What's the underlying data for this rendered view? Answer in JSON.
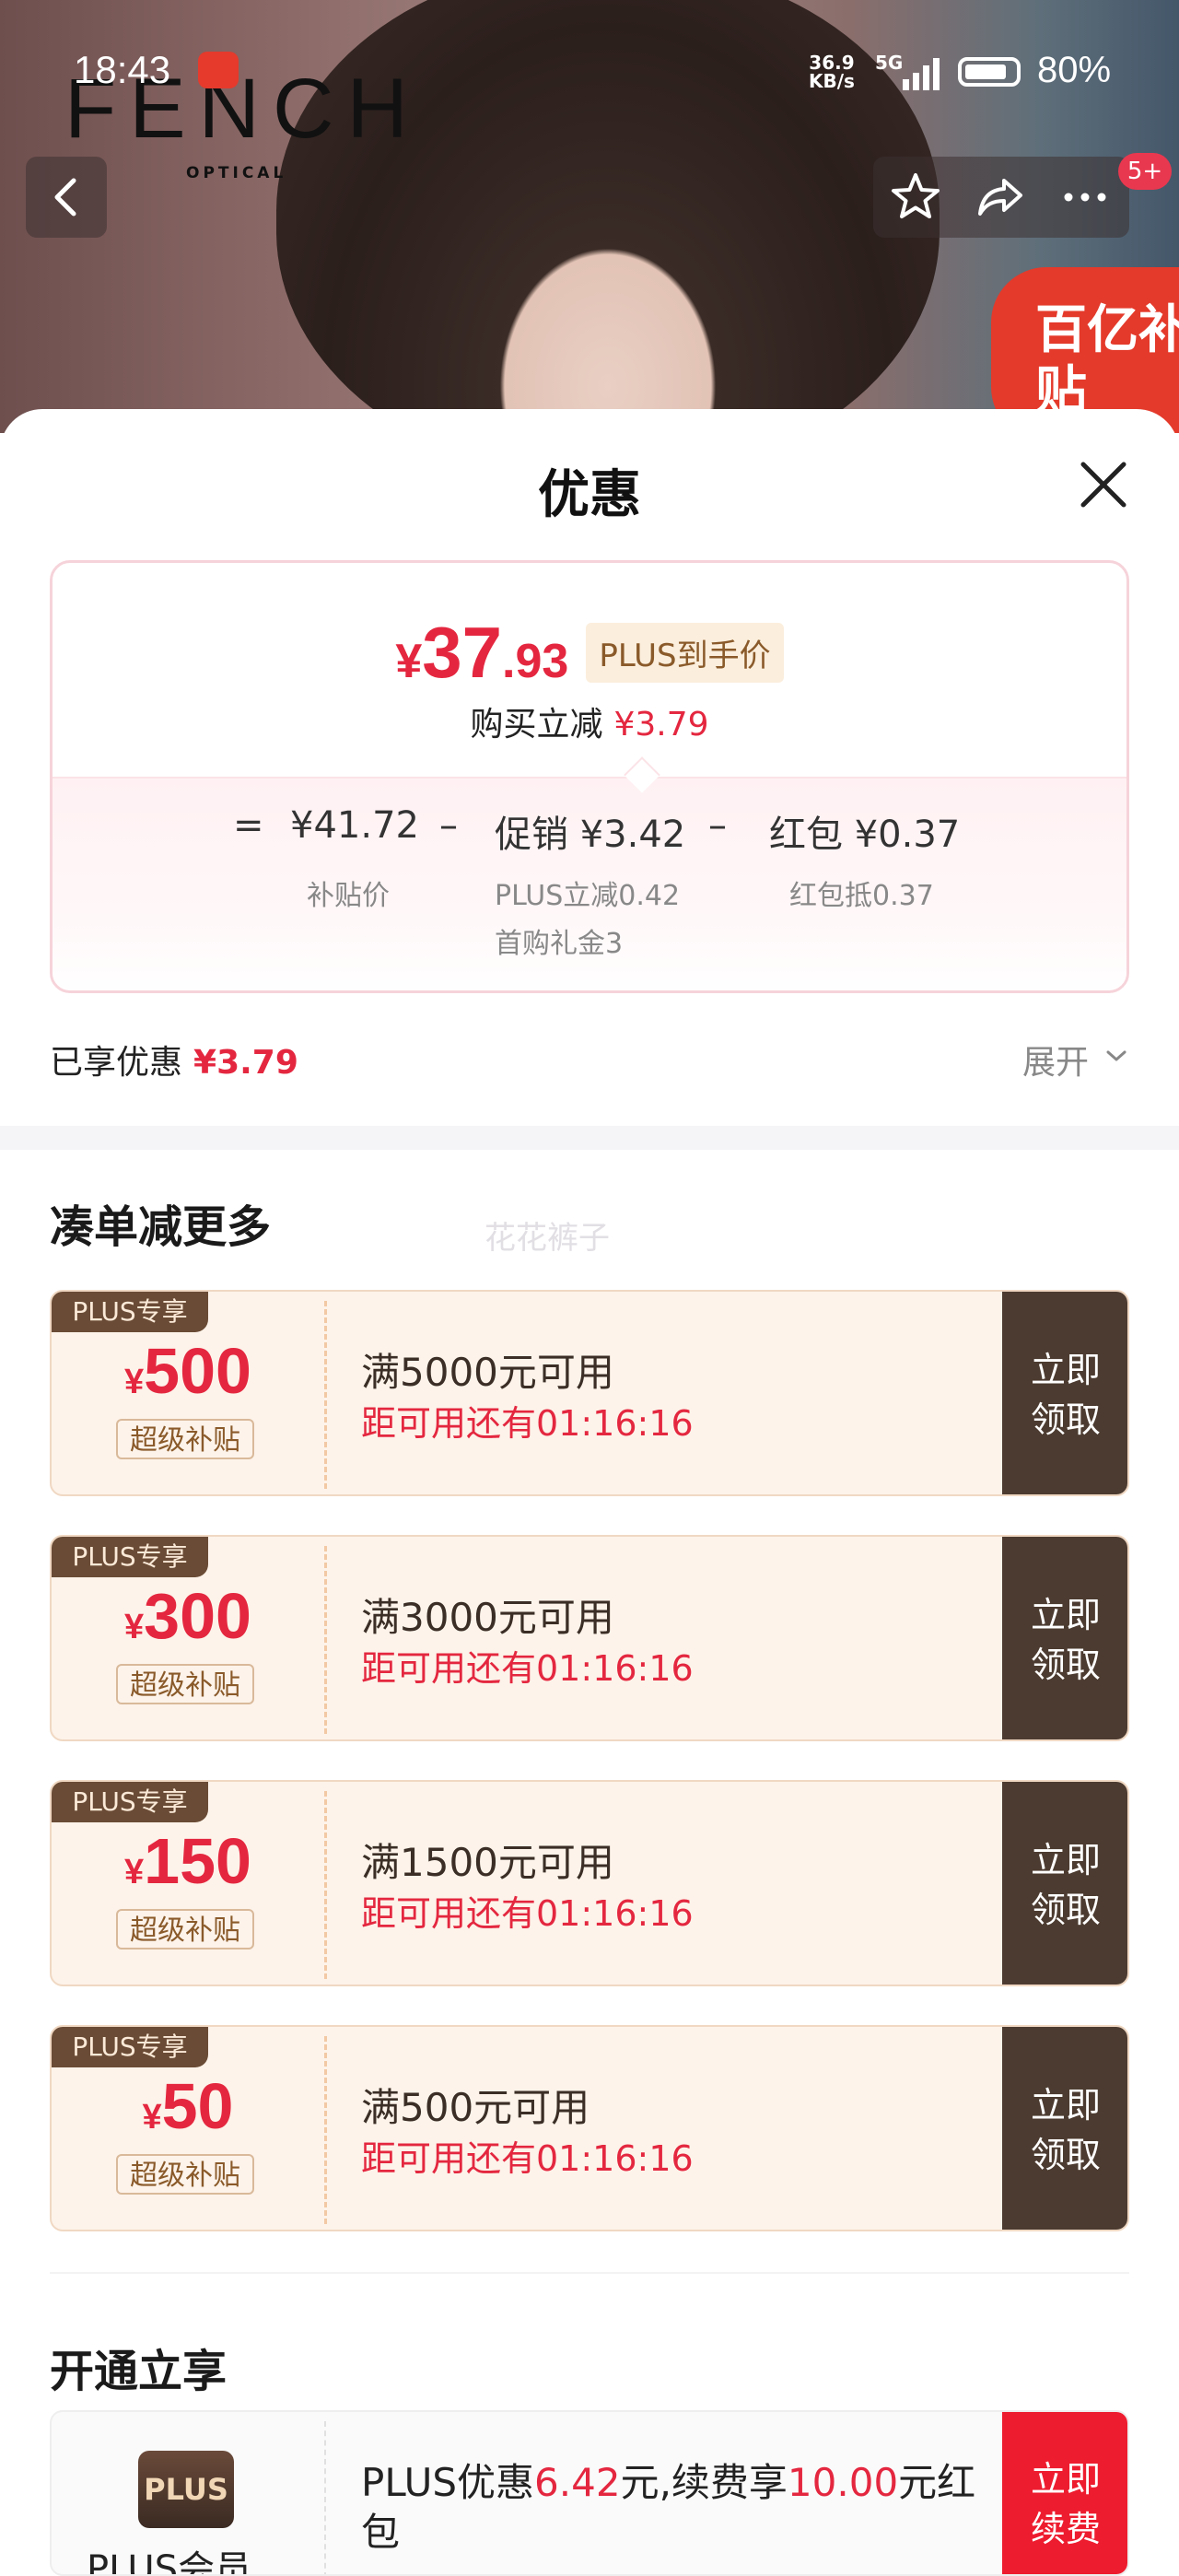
{
  "status_bar": {
    "time": "18:43",
    "net_speed": "36.9",
    "net_unit": "KB/s",
    "network": "5G",
    "battery": "80%"
  },
  "hero": {
    "brand": "FENCH",
    "brand_sub": "OPTICAL",
    "notification_count": "5+",
    "subsidy_badge": "百亿补贴"
  },
  "sheet": {
    "title": "优惠",
    "price": {
      "currency": "¥",
      "integer": "37",
      "decimal": ".93",
      "plus_tag": "PLUS到手价",
      "reduce_label": "购买立减",
      "reduce_value": "¥3.79"
    },
    "breakdown": {
      "eq": "=",
      "subsidy_price": "¥41.72",
      "subsidy_label": "补贴价",
      "minus1": "–",
      "promo": "促销 ¥3.42",
      "promo_sub1": "PLUS立减0.42",
      "promo_sub2": "首购礼金3",
      "minus2": "–",
      "redpacket": "红包 ¥0.37",
      "redpacket_sub": "红包抵0.37"
    },
    "enjoyed_label": "已享优惠",
    "enjoyed_value": "¥3.79",
    "expand_label": "展开"
  },
  "more": {
    "title": "凑单减更多",
    "watermark": "花花裤子",
    "coupons": [
      {
        "tag": "PLUS专享",
        "currency": "¥",
        "amount": "500",
        "subtag": "超级补贴",
        "condition": "满5000元可用",
        "timer": "距可用还有01:16:16",
        "cta1": "立即",
        "cta2": "领取"
      },
      {
        "tag": "PLUS专享",
        "currency": "¥",
        "amount": "300",
        "subtag": "超级补贴",
        "condition": "满3000元可用",
        "timer": "距可用还有01:16:16",
        "cta1": "立即",
        "cta2": "领取"
      },
      {
        "tag": "PLUS专享",
        "currency": "¥",
        "amount": "150",
        "subtag": "超级补贴",
        "condition": "满1500元可用",
        "timer": "距可用还有01:16:16",
        "cta1": "立即",
        "cta2": "领取"
      },
      {
        "tag": "PLUS专享",
        "currency": "¥",
        "amount": "50",
        "subtag": "超级补贴",
        "condition": "满500元可用",
        "timer": "距可用还有01:16:16",
        "cta1": "立即",
        "cta2": "领取"
      }
    ]
  },
  "open": {
    "title": "开通立享",
    "logo": "PLUS",
    "logo_label": "PLUS会员",
    "text_a": "PLUS优惠",
    "text_b": "6.42",
    "text_c": "元,续费享",
    "text_d": "10.00",
    "text_e": "元红包",
    "cta1": "立即",
    "cta2": "续费"
  },
  "colors": {
    "accent_red": "#e4273f",
    "coupon_brown": "#4c3b30",
    "renew_red": "#ee1c2f"
  }
}
